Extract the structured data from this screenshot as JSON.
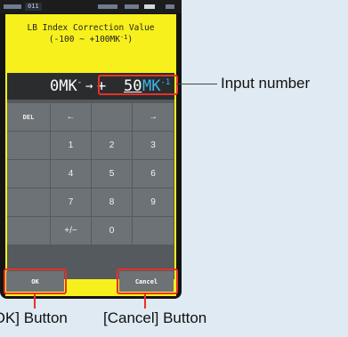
{
  "statusbar": {
    "indicator": "011"
  },
  "screen": {
    "title_line1": "LB Index Correction Value",
    "title_line2": "(-100 ~ +100MK",
    "title_line2_sup": "-1",
    "title_line2_end": ")"
  },
  "display": {
    "current_value": "0MK",
    "current_sup": "-1",
    "arrow": "→",
    "sign": "+",
    "input_number": "50",
    "unit": "MK",
    "unit_sup": "-1"
  },
  "keypad": {
    "del": "DEL",
    "left": "←",
    "right": "→",
    "k1": "1",
    "k2": "2",
    "k3": "3",
    "k4": "4",
    "k5": "5",
    "k6": "6",
    "k7": "7",
    "k8": "8",
    "k9": "9",
    "plusminus": "+/−",
    "k0": "0"
  },
  "buttons": {
    "ok": "OK",
    "cancel": "Cancel"
  },
  "annotations": {
    "input_number": "Input number",
    "ok_button": "[OK] Button",
    "cancel_button": "[Cancel] Button"
  },
  "colors": {
    "screen": "#f7f01c",
    "accent": "#e8302a",
    "unit": "#3ab8f0"
  }
}
